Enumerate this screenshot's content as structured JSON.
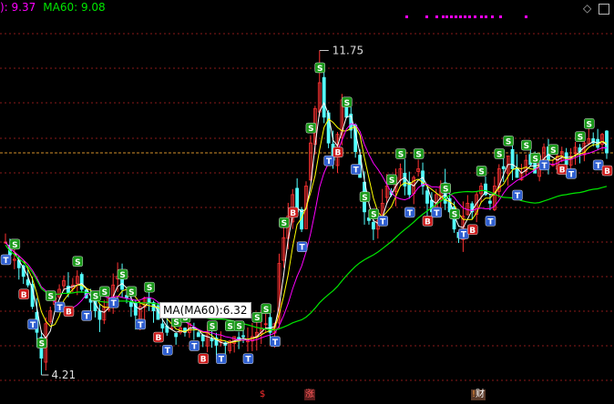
{
  "legend": {
    "ma_prefix": "): 9.37",
    "ma60_label": "MA60: 9.08",
    "ma_prefix_color": "#ff00ff",
    "ma60_color": "#00e600"
  },
  "controls": {
    "diamond": "◇",
    "window": "□"
  },
  "tooltip": {
    "text": "MA(MA60):6.32"
  },
  "annotations": {
    "high": "11.75",
    "low": "4.21"
  },
  "event_tags": [
    {
      "text": "$",
      "color": "#ff3030"
    },
    {
      "text": "涨",
      "color": "#ff3030"
    },
    {
      "text": "财",
      "color": "#ffffff"
    }
  ],
  "colors": {
    "background": "#000000",
    "grid": "#8a1a1a",
    "up": "#ff3232",
    "down": "#54ffff",
    "ma_short": "#ffffff",
    "ma_mid": "#ffff00",
    "ma_long": "#ff00ff",
    "ma60": "#00e600",
    "ref_line": "#d4902a",
    "signal_s": "#1a9a1a",
    "signal_b": "#cc1a1a",
    "signal_t": "#2f5fd0"
  },
  "chart_data": {
    "type": "candlestick",
    "title": "",
    "price_range": [
      4.0,
      12.5
    ],
    "high": 11.75,
    "low": 4.21,
    "reference_price": 9.37,
    "ma60_at_cursor": 6.32,
    "close_path": [
      7.3,
      7.0,
      6.9,
      6.7,
      6.5,
      6.3,
      5.8,
      5.2,
      4.6,
      5.4,
      5.7,
      6.0,
      6.2,
      6.4,
      6.1,
      6.3,
      6.5,
      6.2,
      6.0,
      5.9,
      5.7,
      5.5,
      5.8,
      6.0,
      6.3,
      6.5,
      6.2,
      6.0,
      5.8,
      5.6,
      5.8,
      6.0,
      5.9,
      5.7,
      5.5,
      5.3,
      5.2,
      5.3,
      5.1,
      5.3,
      5.2,
      5.4,
      5.3,
      5.1,
      5.0,
      5.2,
      5.0,
      4.9,
      5.0,
      4.9,
      5.0,
      5.1,
      5.0,
      5.1,
      5.0,
      5.1,
      5.2,
      5.3,
      5.4,
      5.2,
      5.4,
      6.8,
      7.4,
      7.9,
      8.4,
      8.0,
      7.6,
      8.6,
      9.6,
      10.4,
      11.0,
      10.2,
      9.6,
      9.2,
      9.8,
      10.6,
      10.2,
      9.9,
      9.4,
      8.8,
      8.0,
      7.8,
      7.6,
      7.8,
      8.2,
      8.6,
      8.4,
      8.8,
      9.0,
      8.6,
      8.4,
      8.8,
      9.0,
      8.6,
      8.2,
      8.0,
      8.4,
      8.6,
      8.2,
      8.0,
      7.6,
      7.4,
      7.9,
      8.2,
      8.0,
      8.4,
      8.6,
      8.4,
      8.2,
      8.6,
      9.0,
      9.0,
      9.3,
      9.0,
      8.8,
      8.9,
      9.2,
      9.1,
      8.9,
      9.3,
      9.5,
      9.2,
      9.1,
      9.3,
      9.4,
      9.1,
      9.3,
      9.5,
      9.4,
      9.6,
      9.7,
      9.6,
      9.5,
      9.8,
      9.37
    ],
    "grid": true
  }
}
